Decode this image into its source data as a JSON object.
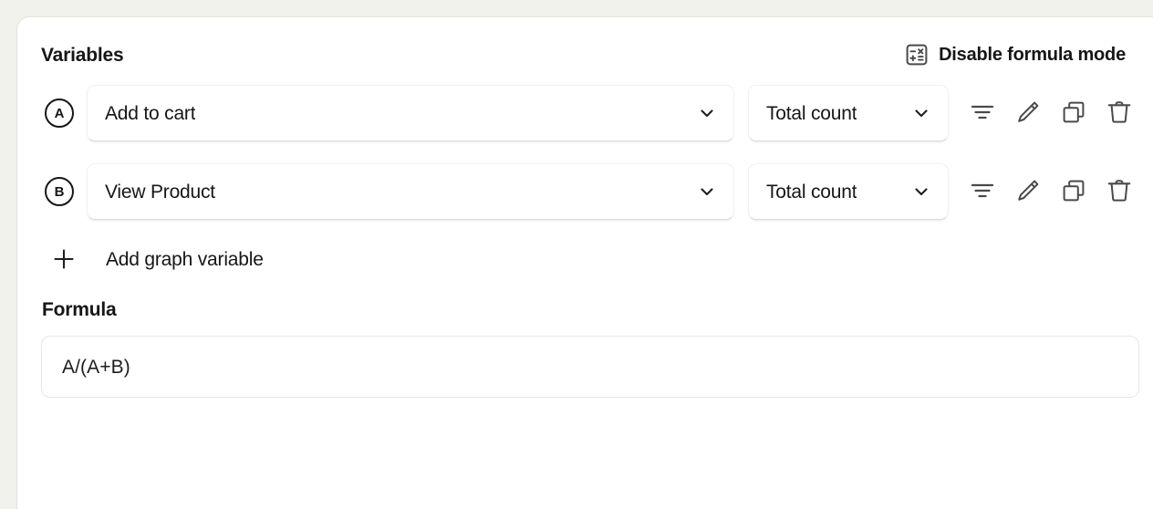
{
  "panel": {
    "variables_title": "Variables",
    "formula_title": "Formula"
  },
  "formula_mode_button": {
    "label": "Disable formula mode",
    "icon": "calculator-icon"
  },
  "variables": [
    {
      "badge": "A",
      "event": "Add to cart",
      "metric": "Total count",
      "actions": [
        "filter-icon",
        "edit-icon",
        "duplicate-icon",
        "delete-icon"
      ]
    },
    {
      "badge": "B",
      "event": "View Product",
      "metric": "Total count",
      "actions": [
        "filter-icon",
        "edit-icon",
        "duplicate-icon",
        "delete-icon"
      ]
    }
  ],
  "add_variable": {
    "label": "Add graph variable",
    "icon": "plus-icon"
  },
  "formula": {
    "value": "A/(A+B)",
    "placeholder": "A/(A+B)"
  },
  "colors": {
    "page_background": "#f2f2ec",
    "card_background": "#ffffff",
    "text": "#161618",
    "icon": "#4a4a4a",
    "border": "#e6e6e1"
  }
}
